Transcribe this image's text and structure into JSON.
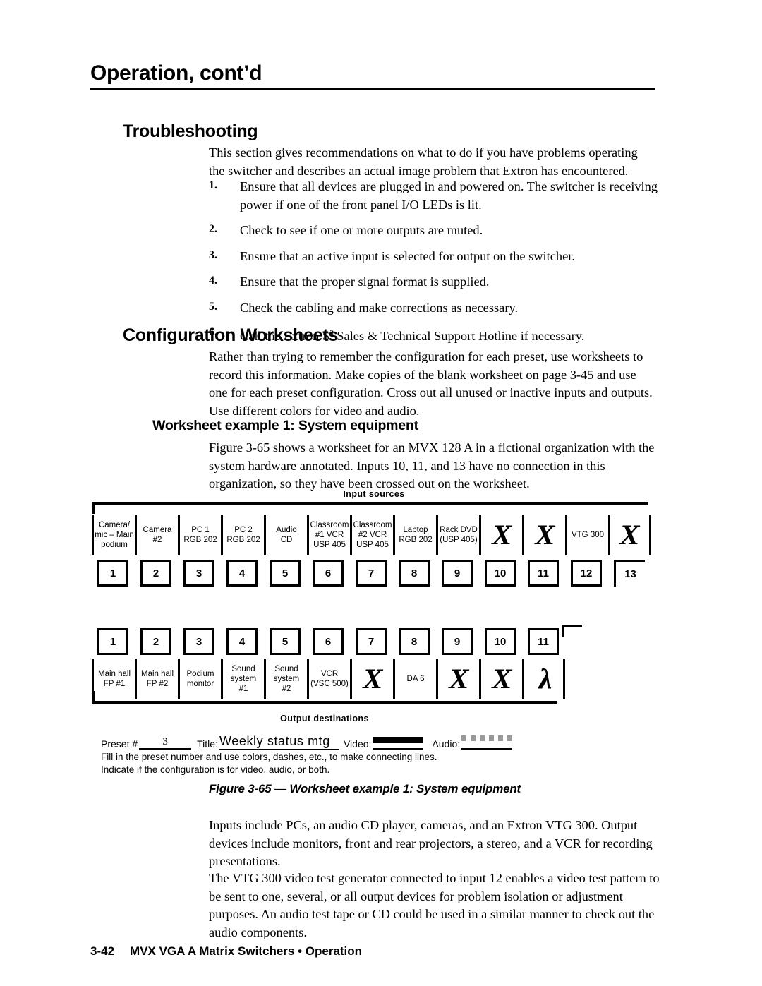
{
  "header": {
    "title": "Operation, cont’d"
  },
  "sections": {
    "troubleshooting": {
      "heading": "Troubleshooting",
      "intro": "This section gives recommendations on what to do if you have problems operating the switcher and describes an actual image problem that Extron has encountered.",
      "steps": [
        {
          "num": "1.",
          "text": "Ensure that all devices are plugged in and powered on.  The switcher is receiving power if one of the front panel I/O LEDs is lit."
        },
        {
          "num": "2.",
          "text": "Check to see if one or more outputs are muted."
        },
        {
          "num": "3.",
          "text": "Ensure that an active input is selected for output on the switcher."
        },
        {
          "num": "4.",
          "text": "Ensure that the proper signal format is supplied."
        },
        {
          "num": "5.",
          "text": "Check the cabling and make corrections as necessary."
        },
        {
          "num": "6.",
          "text_pre": "Call the Extron S",
          "text_sup": "3",
          "text_post": " Sales & Technical Support Hotline if necessary."
        }
      ]
    },
    "worksheets": {
      "heading": "Configuration Worksheets",
      "intro": "Rather than trying to remember the configuration for each preset, use worksheets to record this information.  Make copies of the blank worksheet on page 3-45 and use one for each preset configuration.  Cross out all unused or inactive inputs and outputs.  Use different colors for video and audio.",
      "sub_heading": "Worksheet example 1: System equipment",
      "sub_intro": "Figure 3-65 shows a worksheet for an MVX 128 A in a fictional organization with the system hardware annotated.  Inputs 10, 11, and 13 have no connection in this organization, so they have been crossed out on the worksheet.",
      "after_figure_1": "Inputs include PCs, an audio CD player, cameras, and an Extron VTG 300.  Output devices include monitors, front and rear projectors, a stereo, and a VCR for recording presentations.",
      "after_figure_2": "The VTG 300 video test generator connected to input 12 enables a video test pattern to be sent to one, several, or all output devices for problem isolation or adjustment purposes.  An audio test tape or CD could be used in a similar manner to check out the audio components."
    }
  },
  "worksheet": {
    "top_label": "Input  sources",
    "bottom_label": "Output destinations",
    "inputs": [
      {
        "num": "1",
        "lines": [
          "Camera/",
          "mic – Main",
          "podium"
        ],
        "crossed": false
      },
      {
        "num": "2",
        "lines": [
          "Camera",
          "#2"
        ],
        "crossed": false
      },
      {
        "num": "3",
        "lines": [
          "PC 1",
          "RGB 202"
        ],
        "crossed": false
      },
      {
        "num": "4",
        "lines": [
          "PC 2",
          "RGB 202"
        ],
        "crossed": false
      },
      {
        "num": "5",
        "lines": [
          "Audio",
          "CD"
        ],
        "crossed": false
      },
      {
        "num": "6",
        "lines": [
          "Classroom",
          "#1 VCR",
          "USP 405"
        ],
        "crossed": false
      },
      {
        "num": "7",
        "lines": [
          "Classroom",
          "#2 VCR",
          "USP 405"
        ],
        "crossed": false
      },
      {
        "num": "8",
        "lines": [
          "Laptop",
          "RGB 202"
        ],
        "crossed": false
      },
      {
        "num": "9",
        "lines": [
          "Rack DVD",
          "(USP 405)"
        ],
        "crossed": false
      },
      {
        "num": "10",
        "lines": [],
        "crossed": true
      },
      {
        "num": "11",
        "lines": [],
        "crossed": true
      },
      {
        "num": "12",
        "lines": [
          "VTG 300"
        ],
        "crossed": false
      },
      {
        "num": "13",
        "lines": [],
        "crossed": true
      }
    ],
    "outputs": [
      {
        "num": "1",
        "lines": [
          "Main hall",
          "FP #1"
        ],
        "crossed": false
      },
      {
        "num": "2",
        "lines": [
          "Main hall",
          "FP #2"
        ],
        "crossed": false
      },
      {
        "num": "3",
        "lines": [
          "Podium",
          "monitor"
        ],
        "crossed": false
      },
      {
        "num": "4",
        "lines": [
          "Sound",
          "system",
          "#1"
        ],
        "crossed": false
      },
      {
        "num": "5",
        "lines": [
          "Sound",
          "system",
          "#2"
        ],
        "crossed": false
      },
      {
        "num": "6",
        "lines": [
          "VCR",
          "(VSC 500)"
        ],
        "crossed": false
      },
      {
        "num": "7",
        "lines": [],
        "crossed": true
      },
      {
        "num": "8",
        "lines": [
          "DA 6"
        ],
        "crossed": false
      },
      {
        "num": "9",
        "lines": [],
        "crossed": true
      },
      {
        "num": "10",
        "lines": [],
        "crossed": true
      },
      {
        "num": "11",
        "lines": [],
        "crossed": true,
        "partial": true
      }
    ],
    "cross_glyph": "X",
    "cross_glyph_partial": "λ",
    "preset": {
      "preset_label": "Preset #",
      "preset_value": "3",
      "title_label": "Title:",
      "title_value": "Weekly status mtg",
      "video_label": "Video:",
      "audio_label": "Audio:",
      "note_line_1": "Fill in the preset number and use colors, dashes, etc., to make connecting lines.",
      "note_line_2": "Indicate if the configuration is for video, audio, or both."
    }
  },
  "figure_caption": "Figure 3-65 — Worksheet example 1: System equipment",
  "footer": {
    "page": "3-42",
    "title": "MVX VGA A Matrix Switchers • Operation"
  }
}
